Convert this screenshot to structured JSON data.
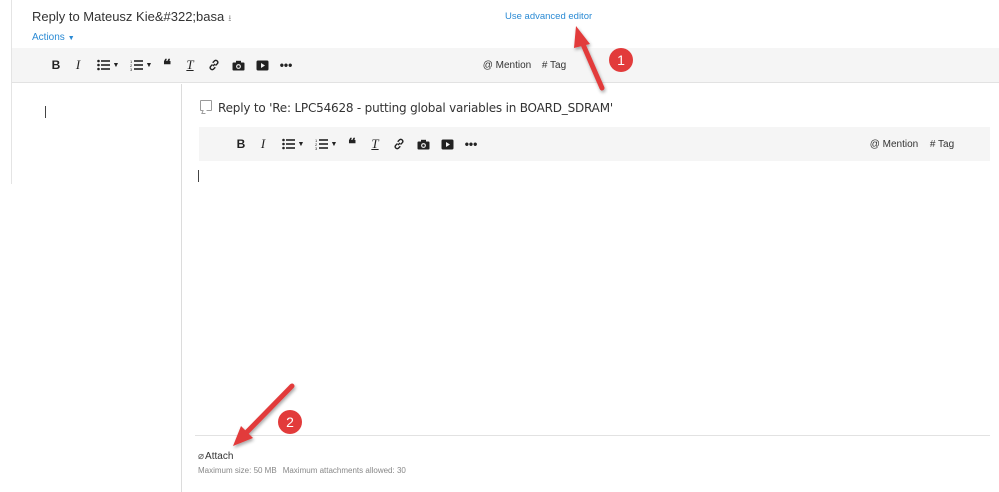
{
  "background_editor": {
    "title": "Reply to Mateusz Kie&#322;basa",
    "title_pin_icon": "pin-icon",
    "advanced_editor_link": "Use advanced editor",
    "actions_label": "Actions",
    "toolbar": {
      "bold": "B",
      "italic": "I",
      "remove_format": "T",
      "mention": "@ Mention",
      "tag": "# Tag"
    }
  },
  "reply_editor": {
    "title": "Reply to 'Re: LPC54628 - putting global variables in BOARD_SDRAM'",
    "toolbar": {
      "bold": "B",
      "italic": "I",
      "remove_format": "T",
      "mention": "@ Mention",
      "tag": "# Tag"
    },
    "attach_label": "Attach",
    "max_size": "Maximum size: 50 MB",
    "max_attachments": "Maximum attachments allowed: 30"
  },
  "annotations": {
    "badge_1": "1",
    "badge_2": "2",
    "color": "#e23b3b"
  },
  "colors": {
    "link": "#2a8ad4",
    "toolbar_bg": "#f5f5f5"
  }
}
